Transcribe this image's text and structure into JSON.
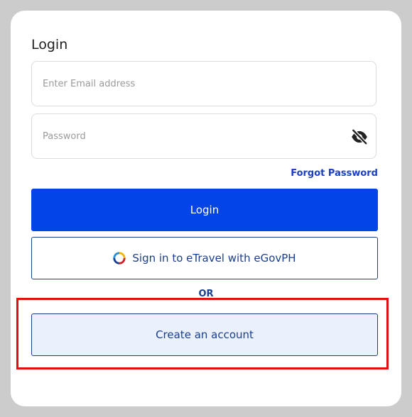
{
  "login": {
    "title": "Login",
    "email_placeholder": "Enter Email address",
    "password_placeholder": "Password",
    "forgot_password": "Forgot Password",
    "login_button": "Login",
    "egov_button": "Sign in to eTravel with eGovPH",
    "or_divider": "OR",
    "create_account_button": "Create an account"
  },
  "colors": {
    "primary": "#0344e8",
    "link": "#1a3fbf",
    "outline": "#1b3e8c",
    "create_bg": "#eaf1fd",
    "highlight": "#e01010"
  },
  "icons": {
    "password_toggle": "eye-off-icon",
    "egov": "egov-logo-icon"
  }
}
